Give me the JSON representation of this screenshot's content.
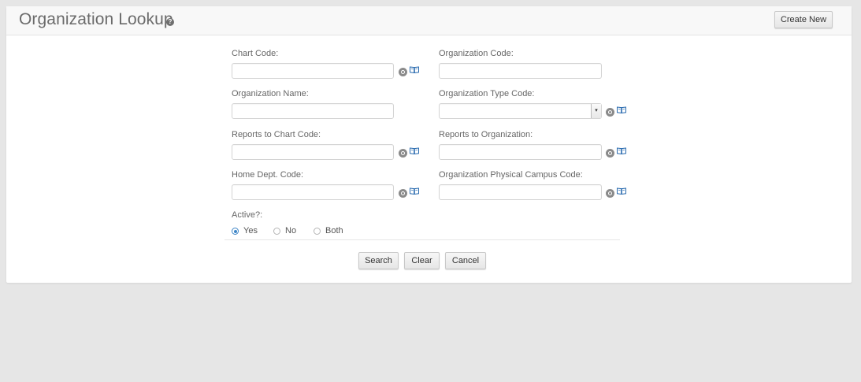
{
  "header": {
    "title": "Organization Lookup",
    "help_glyph": "?",
    "create_new_label": "Create New"
  },
  "form": {
    "chart_code": {
      "label": "Chart Code:",
      "value": ""
    },
    "organization_code": {
      "label": "Organization Code:",
      "value": ""
    },
    "organization_name": {
      "label": "Organization Name:",
      "value": ""
    },
    "organization_type_code": {
      "label": "Organization Type Code:",
      "value": "",
      "arrow": "▾"
    },
    "reports_to_chart_code": {
      "label": "Reports to Chart Code:",
      "value": ""
    },
    "reports_to_organization": {
      "label": "Reports to Organization:",
      "value": ""
    },
    "home_dept_code": {
      "label": "Home Dept. Code:",
      "value": ""
    },
    "org_physical_campus_code": {
      "label": "Organization Physical Campus Code:",
      "value": ""
    },
    "active": {
      "label": "Active?:",
      "options": [
        "Yes",
        "No",
        "Both"
      ],
      "selected": "Yes"
    }
  },
  "actions": {
    "search_label": "Search",
    "clear_label": "Clear",
    "cancel_label": "Cancel"
  },
  "icons": {
    "lookup": "search-icon",
    "direct_inquiry": "book-icon"
  },
  "colors": {
    "page_background": "#e6e6e6",
    "panel_background": "#ffffff",
    "radio_accent": "#3d85c6",
    "book_icon_blue": "#2b6cb0"
  }
}
